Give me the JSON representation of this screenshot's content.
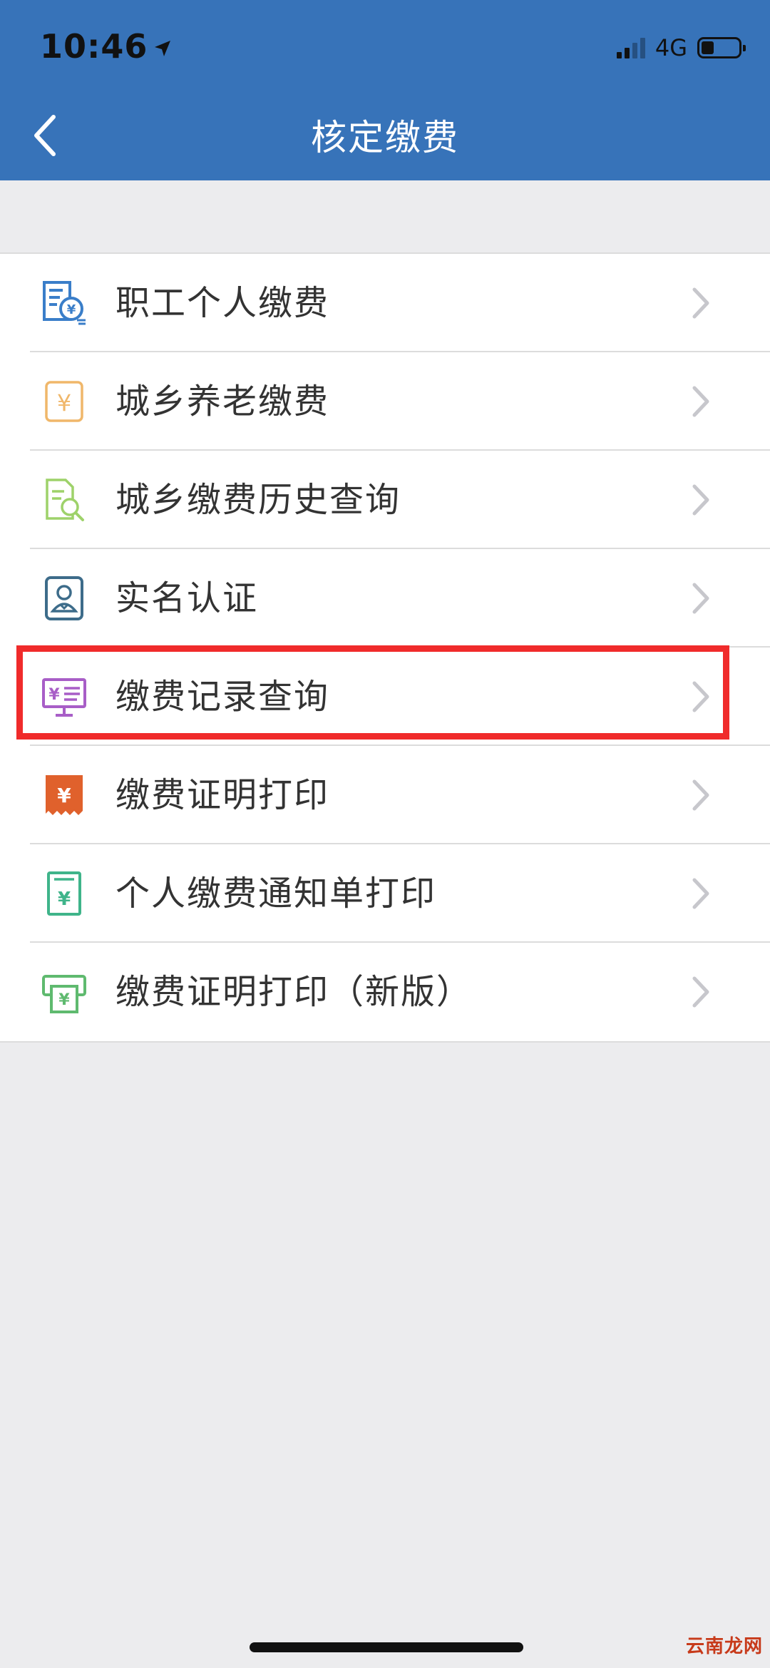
{
  "status_bar": {
    "time": "10:46",
    "network": "4G"
  },
  "nav": {
    "title": "核定缴费"
  },
  "menu": {
    "items": [
      {
        "label": "职工个人缴费",
        "icon": "employee-payment-icon",
        "color": "#3a7ec9"
      },
      {
        "label": "城乡养老缴费",
        "icon": "pension-yuan-icon",
        "color": "#f0b76a"
      },
      {
        "label": "城乡缴费历史查询",
        "icon": "history-search-icon",
        "color": "#9ed26a"
      },
      {
        "label": "实名认证",
        "icon": "id-verify-icon",
        "color": "#3d6c8a"
      },
      {
        "label": "缴费记录查询",
        "icon": "monitor-yuan-icon",
        "color": "#a85ec7"
      },
      {
        "label": "缴费证明打印",
        "icon": "receipt-yuan-icon",
        "color": "#e0612c"
      },
      {
        "label": "个人缴费通知单打印",
        "icon": "notice-yuan-icon",
        "color": "#3fb48a"
      },
      {
        "label": "缴费证明打印（新版）",
        "icon": "print-yuan-icon",
        "color": "#5fba6f"
      }
    ]
  },
  "highlight": {
    "color": "#f02b2b"
  },
  "watermark": "云南龙网"
}
